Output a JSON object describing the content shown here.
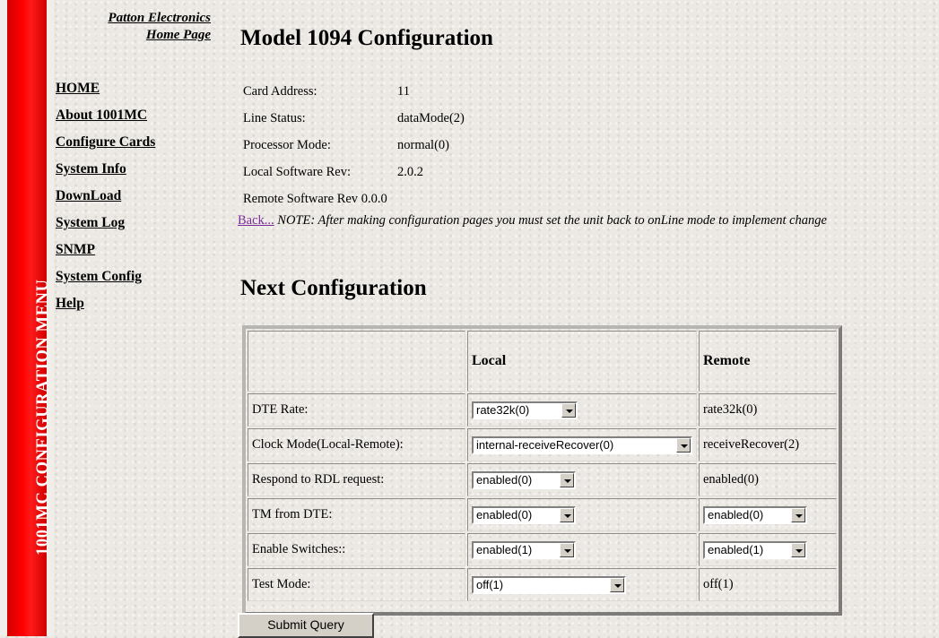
{
  "sidebar": {
    "vertical_title": "1001MC CONFIGURATION MENU",
    "brand_line1": "Patton Electronics",
    "brand_line2": "Home Page",
    "nav": [
      "HOME",
      "About 1001MC",
      "Configure Cards",
      "System Info",
      "DownLoad",
      "System Log",
      "SNMP",
      "System Config",
      "Help"
    ]
  },
  "page": {
    "title": "Model 1094 Configuration",
    "info": [
      {
        "label": "Card Address:",
        "value": "11"
      },
      {
        "label": "Line Status:",
        "value": "dataMode(2)"
      },
      {
        "label": "Processor Mode:",
        "value": "normal(0)"
      },
      {
        "label": "Local Software Rev:",
        "value": "2.0.2"
      },
      {
        "label": "Remote Software Rev",
        "value": "0.0.0"
      }
    ],
    "back_link": "Back...",
    "note": "NOTE: After making configuration pages you must set the unit back to onLine mode to implement change",
    "subtitle": "Next Configuration"
  },
  "config_table": {
    "header_local": "Local",
    "header_remote": "Remote",
    "rows": [
      {
        "label": "DTE Rate:",
        "local": "rate32k(0)",
        "remote": "rate32k(0)"
      },
      {
        "label": "Clock Mode(Local-Remote):",
        "local": "internal-receiveRecover(0)",
        "remote": "receiveRecover(2)"
      },
      {
        "label": "Respond to RDL request:",
        "local": "enabled(0)",
        "remote": "enabled(0)"
      },
      {
        "label": "TM from DTE:",
        "local": "enabled(0)",
        "remote": "enabled(0)"
      },
      {
        "label": "Enable Switches::",
        "local": "enabled(1)",
        "remote": "enabled(1)"
      },
      {
        "label": "Test Mode:",
        "local": "off(1)",
        "remote": "off(1)"
      }
    ]
  },
  "submit_label": "Submit Query",
  "colors": {
    "menu_bar": "#ff0000",
    "visited_link": "#7a2c9a"
  }
}
